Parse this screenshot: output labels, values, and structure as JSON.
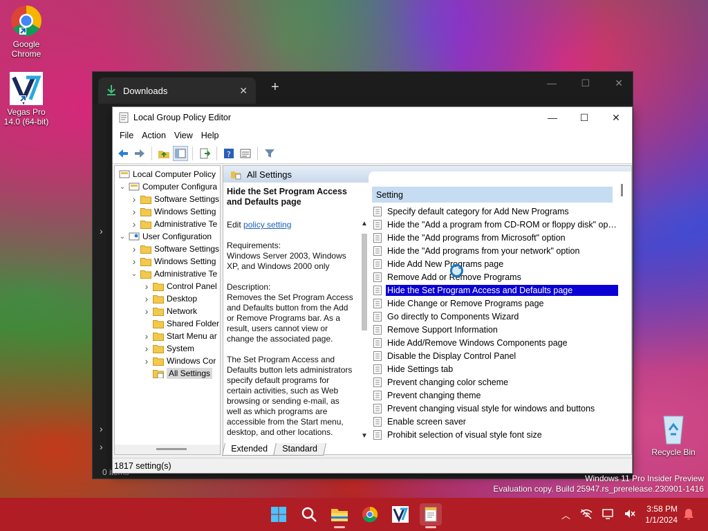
{
  "desktop": {
    "icons": [
      {
        "label": "Google Chrome"
      },
      {
        "label": "Vegas Pro 14.0 (64-bit)"
      },
      {
        "label": "Recycle Bin"
      }
    ]
  },
  "explorer": {
    "tab_title": "Downloads",
    "status": "0 items"
  },
  "gpe": {
    "title": "Local Group Policy Editor",
    "menu": [
      "File",
      "Action",
      "View",
      "Help"
    ],
    "tree": [
      {
        "label": "Local Computer Policy",
        "level": 0,
        "arrow": "",
        "icon": "computer"
      },
      {
        "label": "Computer Configura",
        "level": 0,
        "arrow": "down",
        "icon": "computer"
      },
      {
        "label": "Software Settings",
        "level": 1,
        "arrow": "right",
        "icon": "folder"
      },
      {
        "label": "Windows Setting",
        "level": 1,
        "arrow": "right",
        "icon": "folder"
      },
      {
        "label": "Administrative Te",
        "level": 1,
        "arrow": "right",
        "icon": "folder"
      },
      {
        "label": "User Configuration",
        "level": 0,
        "arrow": "down",
        "icon": "user"
      },
      {
        "label": "Software Settings",
        "level": 1,
        "arrow": "right",
        "icon": "folder"
      },
      {
        "label": "Windows Setting",
        "level": 1,
        "arrow": "right",
        "icon": "folder"
      },
      {
        "label": "Administrative Te",
        "level": 1,
        "arrow": "down",
        "icon": "folder"
      },
      {
        "label": "Control Panel",
        "level": 2,
        "arrow": "right",
        "icon": "folder"
      },
      {
        "label": "Desktop",
        "level": 2,
        "arrow": "right",
        "icon": "folder"
      },
      {
        "label": "Network",
        "level": 2,
        "arrow": "right",
        "icon": "folder"
      },
      {
        "label": "Shared Folder",
        "level": 2,
        "arrow": "",
        "icon": "folder"
      },
      {
        "label": "Start Menu ar",
        "level": 2,
        "arrow": "right",
        "icon": "folder"
      },
      {
        "label": "System",
        "level": 2,
        "arrow": "right",
        "icon": "folder"
      },
      {
        "label": "Windows Cor",
        "level": 2,
        "arrow": "right",
        "icon": "folder"
      },
      {
        "label": "All Settings",
        "level": 2,
        "arrow": "",
        "icon": "settings",
        "selected": true
      }
    ],
    "pane_header": "All Settings",
    "description": {
      "heading": "Hide the Set Program Access and Defaults page",
      "edit_prefix": "Edit",
      "edit_link": "policy setting",
      "requirements": "Requirements:\nWindows Server 2003, Windows XP, and Windows 2000 only",
      "description": "Description:\nRemoves the Set Program Access and Defaults button from the Add or Remove Programs bar.  As a result, users cannot view or change the associated page.",
      "more": "The Set Program Access and Defaults button lets administrators specify default programs for certain activities, such as Web browsing or sending e-mail, as well as which programs are accessible from the Start menu, desktop, and other locations."
    },
    "list_header": "Setting",
    "settings": [
      "Specify default category for Add New Programs",
      "Hide the \"Add a program from CD-ROM or floppy disk\" opti...",
      "Hide the \"Add programs from Microsoft\" option",
      "Hide the \"Add programs from your network\" option",
      "Hide Add New Programs page",
      "Remove Add or Remove Programs",
      "Hide the Set Program Access and Defaults page",
      "Hide Change or Remove Programs page",
      "Go directly to Components Wizard",
      "Remove Support Information",
      "Hide Add/Remove Windows Components page",
      "Disable the Display Control Panel",
      "Hide Settings tab",
      "Prevent changing color scheme",
      "Prevent changing theme",
      "Prevent changing visual style for windows and buttons",
      "Enable screen saver",
      "Prohibit selection of visual style font size"
    ],
    "selected_index": 6,
    "tabs": [
      "Extended",
      "Standard"
    ],
    "active_tab": 0,
    "status": "1817 setting(s)"
  },
  "watermark": {
    "line1": "Windows 11 Pro Insider Preview",
    "line2": "Evaluation copy. Build 25947.rs_prerelease.230901-1416"
  },
  "taskbar": {
    "time": "3:58 PM",
    "date": "1/1/2024"
  },
  "colors": {
    "selection": "#0a00d4",
    "taskbar": "#b01d24",
    "header_blue": "#c5dcf3"
  }
}
